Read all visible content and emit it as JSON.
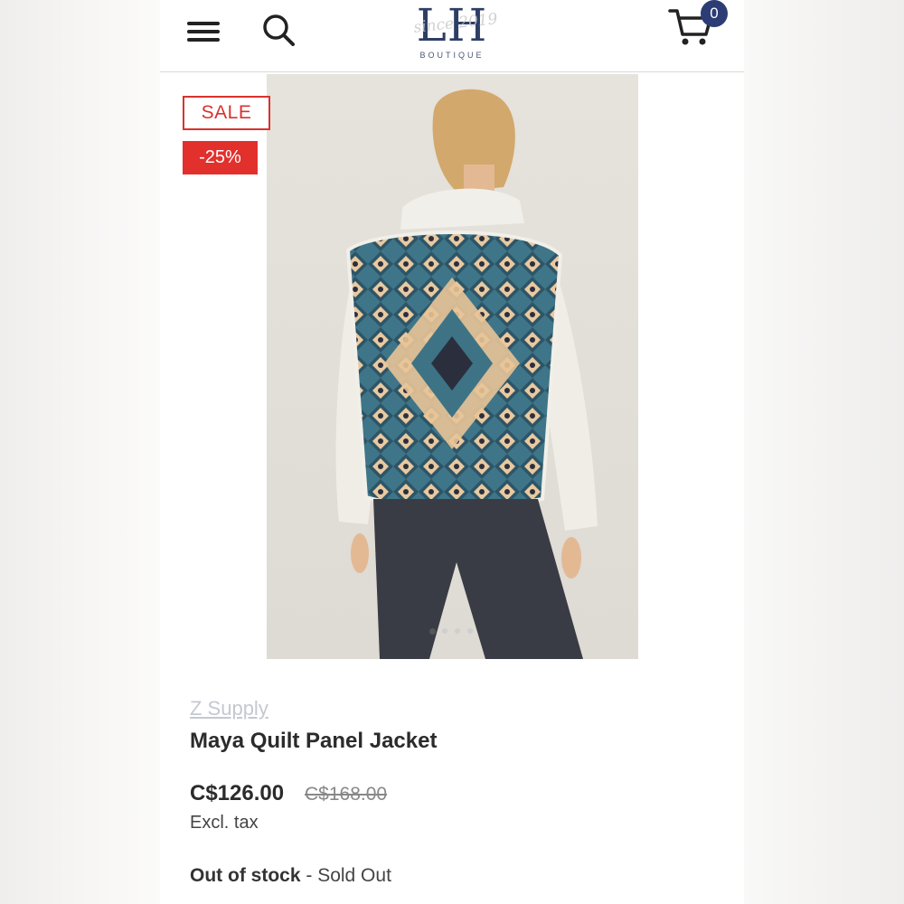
{
  "header": {
    "logo_text": "LH",
    "logo_script": "since 2019",
    "logo_subtitle": "BOUTIQUE",
    "cart_count": "0",
    "icons": [
      "hamburger-menu-icon",
      "search-icon",
      "cart-icon"
    ]
  },
  "badges": {
    "sale": "SALE",
    "discount": "-25%",
    "sale_color": "#d9322e"
  },
  "gallery": {
    "image_count": 4,
    "active_index": 0
  },
  "product": {
    "vendor": "Z Supply",
    "title": "Maya Quilt Panel Jacket",
    "price": "C$126.00",
    "compare_price": "C$168.00",
    "tax_note": "Excl. tax",
    "stock_status": "Out of stock",
    "stock_separator": " - ",
    "stock_detail": "Sold Out"
  },
  "colors": {
    "brand_navy": "#2d3e66",
    "badge_navy": "#2b3d74",
    "sale_red": "#e2302c"
  }
}
